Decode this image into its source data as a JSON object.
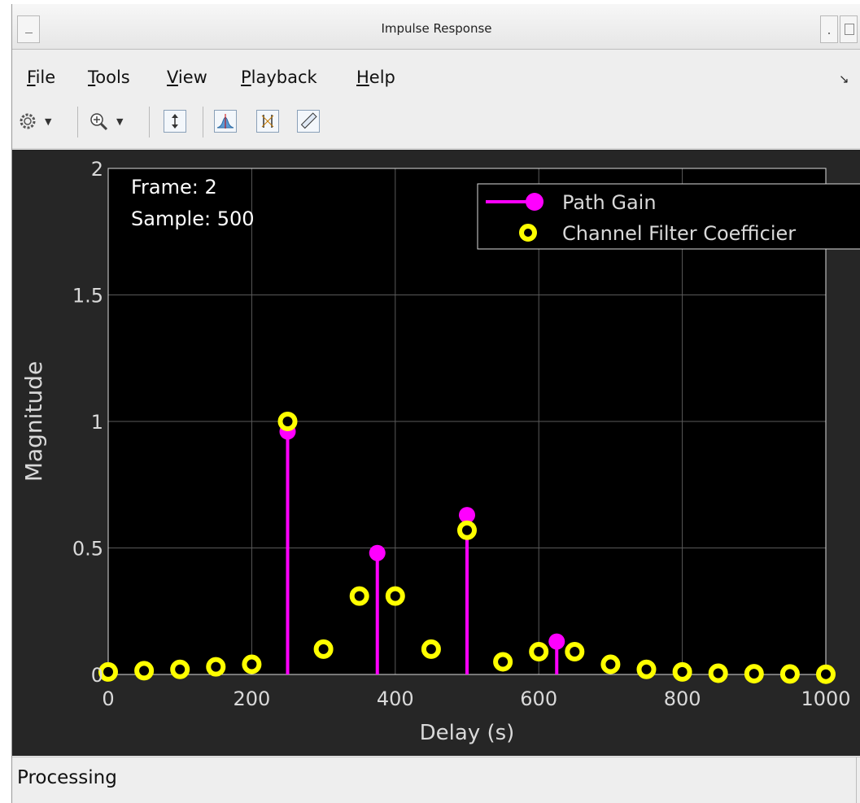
{
  "window": {
    "title": "Impulse Response"
  },
  "menu": [
    {
      "id": "file",
      "label": "File",
      "mnemonic": "F",
      "rest": "ile"
    },
    {
      "id": "tools",
      "label": "Tools",
      "mnemonic": "T",
      "rest": "ools"
    },
    {
      "id": "view",
      "label": "View",
      "mnemonic": "V",
      "rest": "iew"
    },
    {
      "id": "playback",
      "label": "Playback",
      "mnemonic": "P",
      "rest": "layback"
    },
    {
      "id": "help",
      "label": "Help",
      "mnemonic": "H",
      "rest": "elp"
    }
  ],
  "toolbar": {
    "icons": [
      "settings-icon",
      "zoom-in-icon",
      "scale-axes-icon",
      "signal-peak-icon",
      "cursor-measurement-icon",
      "ruler-measure-icon"
    ]
  },
  "status": {
    "text": "Processing"
  },
  "colors": {
    "path_gain": "#ff00ff",
    "channel_filter": "#ffff00",
    "axes_background": "#000000",
    "figure_background": "#262626",
    "grid": "#5a5a5a",
    "text": "#d9d9d9"
  },
  "chart_data": {
    "type": "scatter",
    "title": "",
    "xlabel": "Delay (s)",
    "ylabel": "Magnitude",
    "xlim": [
      0,
      1000
    ],
    "ylim": [
      0,
      2
    ],
    "xticks": [
      0,
      200,
      400,
      600,
      800,
      1000
    ],
    "yticks": [
      0,
      0.5,
      1,
      1.5,
      2
    ],
    "xtick_labels": [
      "0",
      "200",
      "400",
      "600",
      "800",
      "1000"
    ],
    "ytick_labels": [
      "0",
      "0.5",
      "1",
      "1.5",
      "2"
    ],
    "grid": true,
    "legend_position": "top-right",
    "annotations": [
      "Frame: 2",
      "Sample: 500"
    ],
    "series": [
      {
        "name": "Path Gain",
        "style": "stem",
        "x": [
          250,
          375,
          500,
          625
        ],
        "y": [
          0.96,
          0.48,
          0.63,
          0.13
        ]
      },
      {
        "name": "Channel Filter Coefficier",
        "style": "ring-marker",
        "x": [
          0,
          50,
          100,
          150,
          200,
          250,
          300,
          350,
          400,
          450,
          500,
          550,
          600,
          650,
          700,
          750,
          800,
          850,
          900,
          950,
          1000
        ],
        "y": [
          0.01,
          0.015,
          0.02,
          0.03,
          0.04,
          1.0,
          0.1,
          0.31,
          0.31,
          0.1,
          0.57,
          0.05,
          0.09,
          0.09,
          0.04,
          0.02,
          0.01,
          0.005,
          0.003,
          0.002,
          0.001
        ]
      }
    ]
  }
}
